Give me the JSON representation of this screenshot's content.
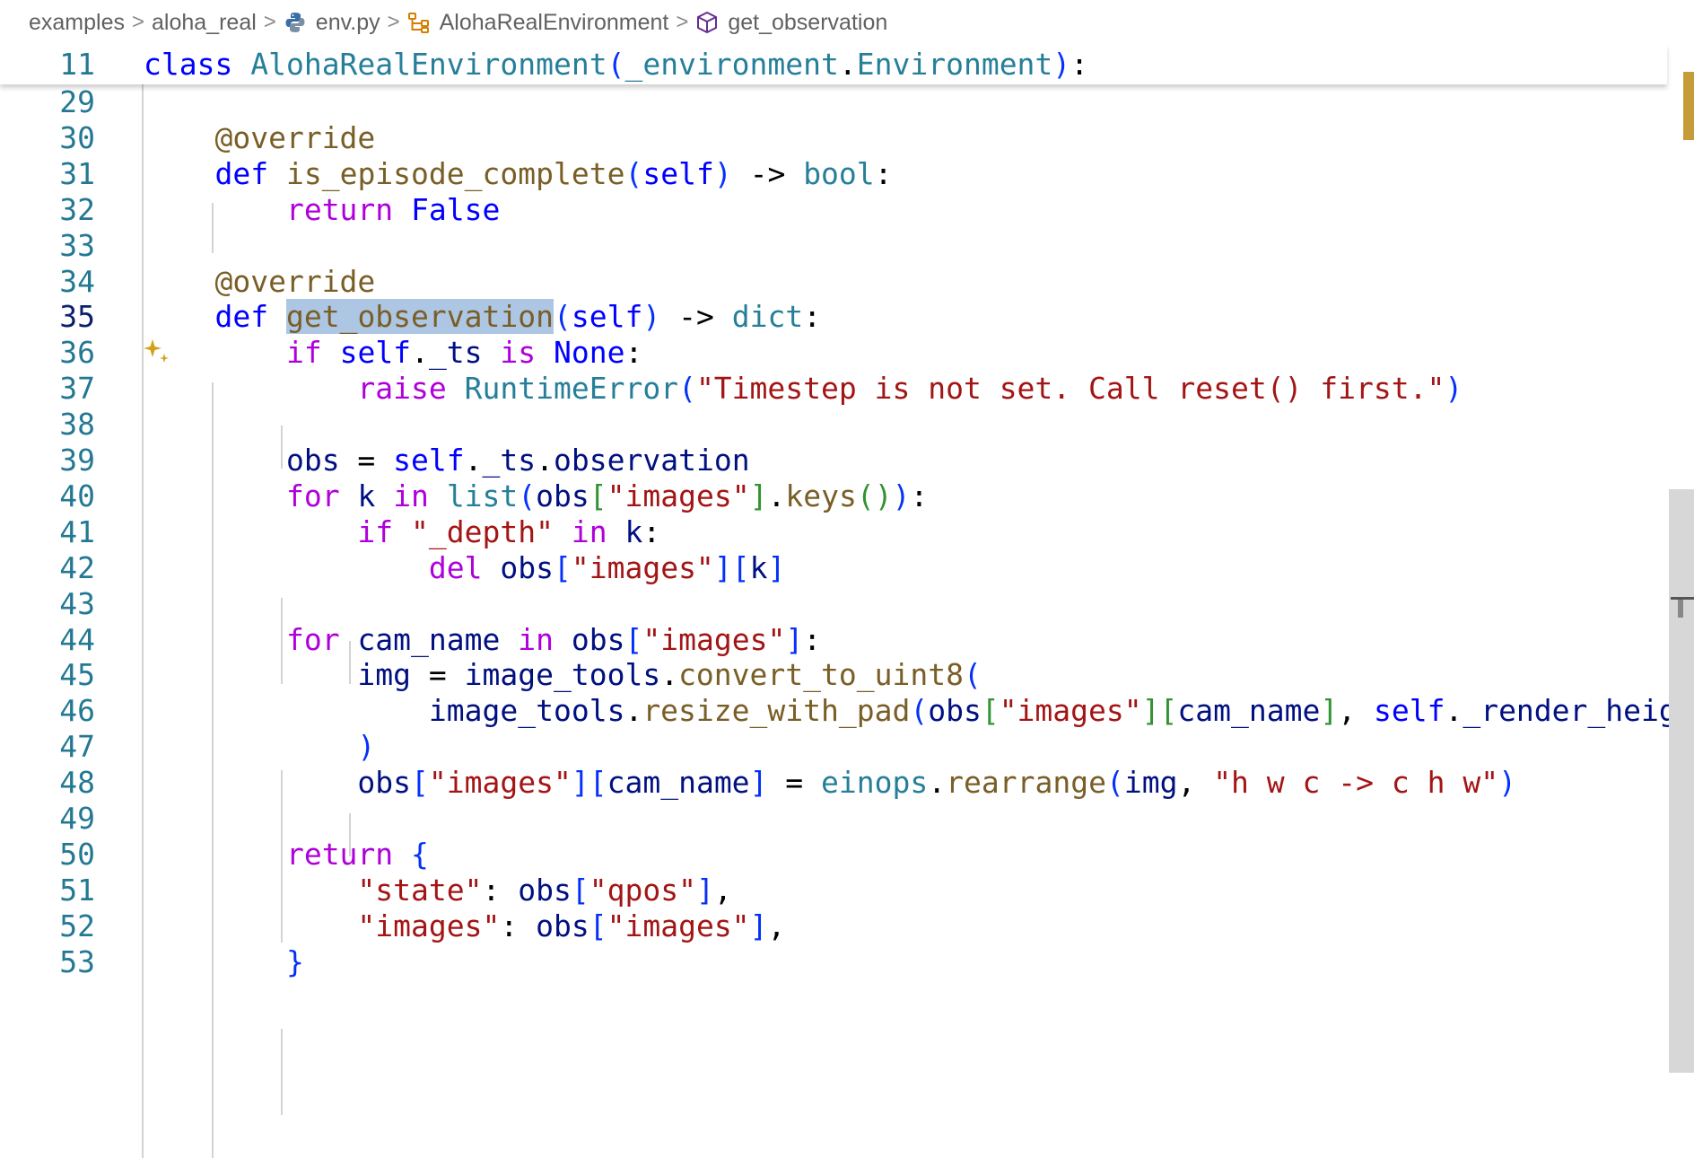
{
  "breadcrumb": {
    "items": [
      {
        "label": "examples",
        "icon": null
      },
      {
        "label": "aloha_real",
        "icon": null
      },
      {
        "label": "env.py",
        "icon": "python-file-icon"
      },
      {
        "label": "AlohaRealEnvironment",
        "icon": "class-symbol-icon"
      },
      {
        "label": "get_observation",
        "icon": "method-cube-icon"
      }
    ],
    "separator": ">"
  },
  "sticky_line": {
    "number": "11",
    "code": "class AlohaRealEnvironment(_environment.Environment):"
  },
  "active_line": "35",
  "selected_text": "get_observation",
  "lines": [
    {
      "n": "29",
      "code": ""
    },
    {
      "n": "30",
      "code": "    @override"
    },
    {
      "n": "31",
      "code": "    def is_episode_complete(self) -> bool:"
    },
    {
      "n": "32",
      "code": "        return False"
    },
    {
      "n": "33",
      "code": ""
    },
    {
      "n": "34",
      "code": "    @override"
    },
    {
      "n": "35",
      "code": "    def get_observation(self) -> dict:"
    },
    {
      "n": "36",
      "code": "        if self._ts is None:"
    },
    {
      "n": "37",
      "code": "            raise RuntimeError(\"Timestep is not set. Call reset() first.\")"
    },
    {
      "n": "38",
      "code": ""
    },
    {
      "n": "39",
      "code": "        obs = self._ts.observation"
    },
    {
      "n": "40",
      "code": "        for k in list(obs[\"images\"].keys()):"
    },
    {
      "n": "41",
      "code": "            if \"_depth\" in k:"
    },
    {
      "n": "42",
      "code": "                del obs[\"images\"][k]"
    },
    {
      "n": "43",
      "code": ""
    },
    {
      "n": "44",
      "code": "        for cam_name in obs[\"images\"]:"
    },
    {
      "n": "45",
      "code": "            img = image_tools.convert_to_uint8("
    },
    {
      "n": "46",
      "code": "                image_tools.resize_with_pad(obs[\"images\"][cam_name], self._render_height,"
    },
    {
      "n": "47",
      "code": "            )"
    },
    {
      "n": "48",
      "code": "            obs[\"images\"][cam_name] = einops.rearrange(img, \"h w c -> c h w\")"
    },
    {
      "n": "49",
      "code": ""
    },
    {
      "n": "50",
      "code": "        return {"
    },
    {
      "n": "51",
      "code": "            \"state\": obs[\"qpos\"],"
    },
    {
      "n": "52",
      "code": "            \"images\": obs[\"images\"],"
    },
    {
      "n": "53",
      "code": "        }"
    }
  ],
  "colors": {
    "keyword": "#0000ff",
    "control": "#af00db",
    "function": "#795e26",
    "type": "#267f99",
    "string": "#a31515",
    "variable": "#001080",
    "line_number": "#237893",
    "selection": "#adc6e4",
    "sparkle": "#d4a017"
  },
  "gutter_icon": "sparkle-icon"
}
